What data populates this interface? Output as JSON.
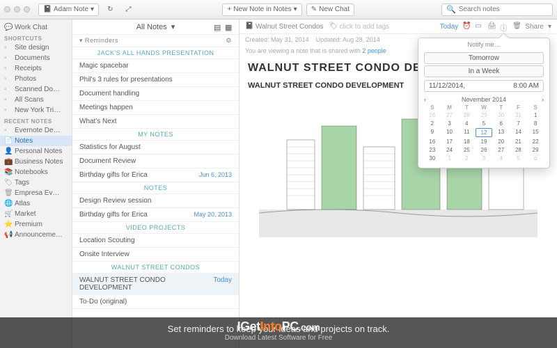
{
  "toolbar": {
    "notebook_selector": "Adam Note",
    "new_note_label": "New Note in Notes",
    "new_chat_label": "New Chat",
    "search_placeholder": "Search notes",
    "share_label": "Share"
  },
  "sidebar": {
    "work_chat": "Work Chat",
    "sections": [
      {
        "head": "SHORTCUTS",
        "items": [
          "Site design",
          "Documents",
          "Receipts",
          "Photos",
          "Scanned Do…",
          "All Scans",
          "New York Tri…"
        ]
      },
      {
        "head": "RECENT NOTES",
        "items": [
          "Evernote De…"
        ]
      }
    ],
    "main_items": [
      "Notes",
      "Personal Notes",
      "Business Notes",
      "Notebooks",
      "Tags",
      "Empresa Ev…",
      "Atlas",
      "Market",
      "Premium",
      "Announceme…"
    ],
    "selected": "Notes"
  },
  "notelist": {
    "title": "All Notes",
    "reminders_label": "Reminders",
    "groups": [
      {
        "section": "JACK'S ALL HANDS PRESENTATION",
        "rows": [
          {
            "t": "Magic spacebar"
          },
          {
            "t": "Phil's 3 rules for presentations"
          },
          {
            "t": "Document handling"
          },
          {
            "t": "Meetings happen"
          },
          {
            "t": "What's Next"
          }
        ]
      },
      {
        "section": "MY NOTES",
        "rows": [
          {
            "t": "Statistics for August"
          },
          {
            "t": "Document Review"
          },
          {
            "t": "Birthday gifts for Erica",
            "d": "Jun 6, 2013"
          }
        ]
      },
      {
        "section": "NOTES",
        "rows": [
          {
            "t": "Design Review session"
          },
          {
            "t": "Birthday gifts for Erica",
            "d": "May 20, 2013"
          }
        ]
      },
      {
        "section": "VIDEO PROJECTS",
        "rows": [
          {
            "t": "Location Scouting"
          },
          {
            "t": "Onsite Interview"
          }
        ]
      },
      {
        "section": "WALNUT STREET CONDOS",
        "rows": [
          {
            "t": "WALNUT STREET CONDO DEVELOPMENT",
            "d": "Today",
            "sel": true
          },
          {
            "t": "To-Do (original)"
          }
        ]
      }
    ]
  },
  "editor": {
    "note_title": "Walnut Street Condos",
    "tags_placeholder": "click to add tags",
    "today": "Today",
    "created_label": "Created:",
    "created_val": "May 31, 2014",
    "updated_label": "Updated:",
    "updated_val": "Aug 28, 2014",
    "share_text_pre": "You are viewing a note that is shared with ",
    "share_text_link": "2 people",
    "h1": "WALNUT STREET CONDO DEVELO",
    "h2": "WALNUT STREET CONDO DEVELOPMENT"
  },
  "popover": {
    "notify_label": "Notify me…",
    "tomorrow": "Tomorrow",
    "in_a_week": "In a Week",
    "date": "11/12/2014,",
    "time": "8:00 AM",
    "month": "November 2014",
    "dayheads": [
      "S",
      "M",
      "T",
      "W",
      "T",
      "F",
      "S"
    ],
    "days": [
      {
        "n": 26,
        "o": 1
      },
      {
        "n": 27,
        "o": 1
      },
      {
        "n": 28,
        "o": 1
      },
      {
        "n": 29,
        "o": 1
      },
      {
        "n": 30,
        "o": 1
      },
      {
        "n": 31,
        "o": 1
      },
      {
        "n": 1
      },
      {
        "n": 2
      },
      {
        "n": 3
      },
      {
        "n": 4
      },
      {
        "n": 5
      },
      {
        "n": 6
      },
      {
        "n": 7
      },
      {
        "n": 8
      },
      {
        "n": 9
      },
      {
        "n": 10
      },
      {
        "n": 11
      },
      {
        "n": 12,
        "s": 1
      },
      {
        "n": 13
      },
      {
        "n": 14
      },
      {
        "n": 15
      },
      {
        "n": 16
      },
      {
        "n": 17
      },
      {
        "n": 18
      },
      {
        "n": 19
      },
      {
        "n": 20
      },
      {
        "n": 21
      },
      {
        "n": 22
      },
      {
        "n": 23
      },
      {
        "n": 24
      },
      {
        "n": 25
      },
      {
        "n": 26
      },
      {
        "n": 27
      },
      {
        "n": 28
      },
      {
        "n": 29
      },
      {
        "n": 30
      },
      {
        "n": 1,
        "o": 1
      },
      {
        "n": 2,
        "o": 1
      },
      {
        "n": 3,
        "o": 1
      },
      {
        "n": 4,
        "o": 1
      },
      {
        "n": 5,
        "o": 1
      },
      {
        "n": 6,
        "o": 1
      }
    ]
  },
  "footer": {
    "tagline": "Set reminders to keep your ideas and projects on track.",
    "sub": "Download Latest Software for Free"
  },
  "watermark": {
    "pre": "IGet",
    "mid": "Into",
    "post": "PC",
    "suffix": ".com"
  }
}
